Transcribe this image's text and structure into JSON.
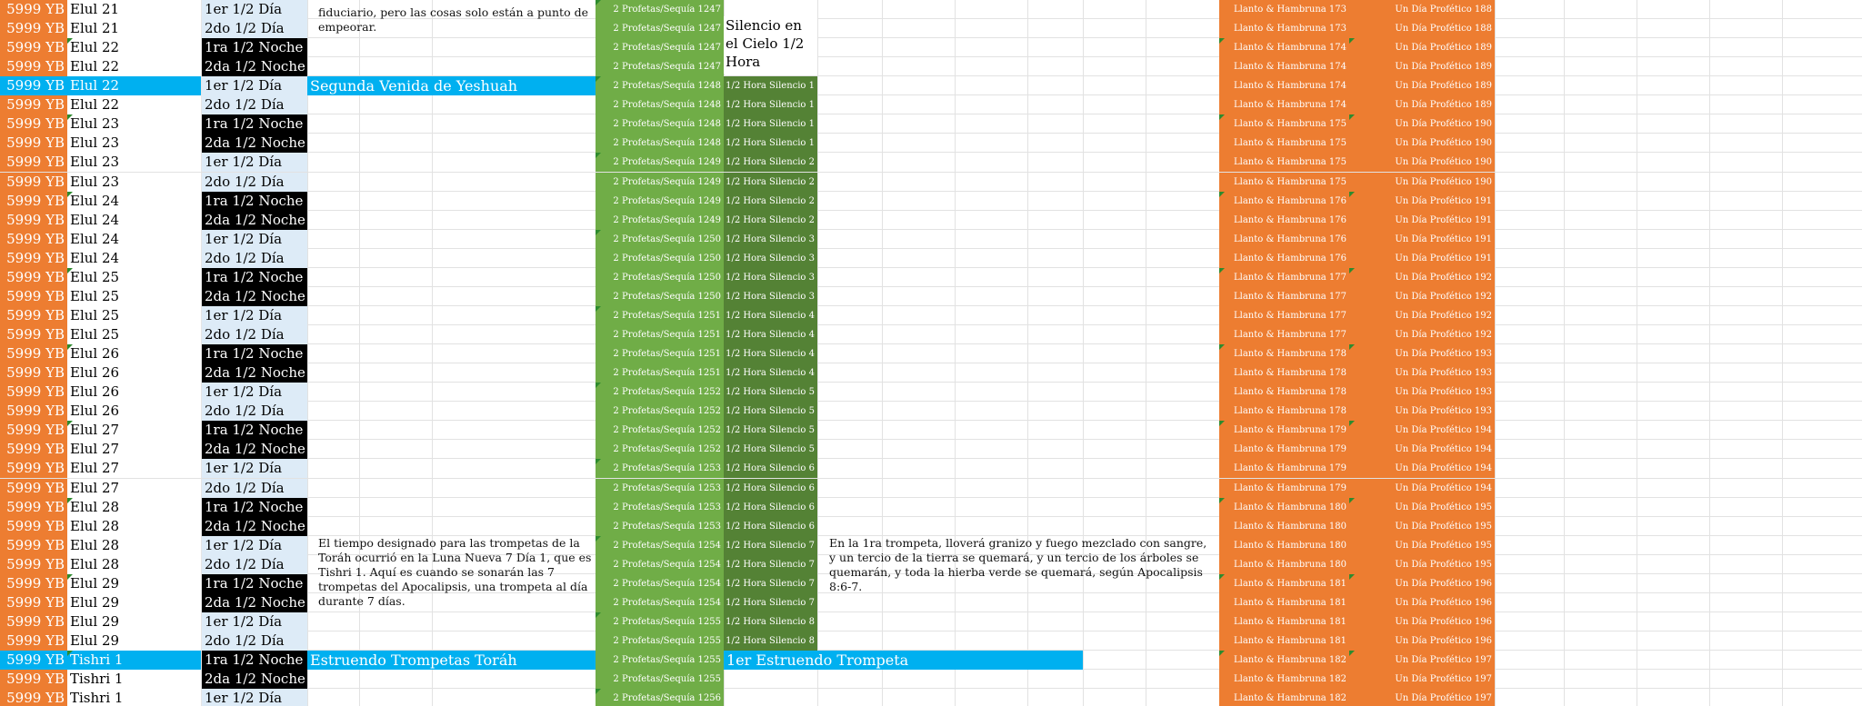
{
  "sheet": {
    "colors": {
      "orange": "#ed7d31",
      "cyan": "#00b0f0",
      "green": "#70ad47",
      "dark_green": "#548235",
      "day_blue": "#ddebf7",
      "night_black": "#000000"
    },
    "rows": [
      {
        "year": "5999 YB",
        "day": "Elul 21",
        "half": "1er 1/2 Día",
        "half_type": "d",
        "pro": "2 Profetas/Sequía  1247",
        "sil": "",
        "lla": "Llanto & Hambruna 173",
        "una": "Un Día Profético  188",
        "hi": false,
        "mark": false
      },
      {
        "year": "5999 YB",
        "day": "Elul 21",
        "half": "2do 1/2 Día",
        "half_type": "d",
        "pro": "2 Profetas/Sequía  1247",
        "sil": "",
        "lla": "Llanto & Hambruna 173",
        "una": "Un Día Profético  188",
        "hi": false,
        "mark": false
      },
      {
        "year": "5999 YB",
        "day": "Elul 22",
        "half": "1ra 1/2 Noche",
        "half_type": "n",
        "pro": "2 Profetas/Sequía  1247",
        "sil": "",
        "lla": "Llanto & Hambruna 174",
        "una": "Un Día Profético  189",
        "hi": false,
        "mark": true
      },
      {
        "year": "5999 YB",
        "day": "Elul 22",
        "half": "2da 1/2 Noche",
        "half_type": "n",
        "pro": "2 Profetas/Sequía  1247",
        "sil": "",
        "lla": "Llanto & Hambruna 174",
        "una": "Un Día Profético  189",
        "hi": false,
        "mark": false
      },
      {
        "year": "5999 YB",
        "day": "Elul 22",
        "half": "1er 1/2 Día",
        "half_type": "d",
        "pro": "2 Profetas/Sequía  1248",
        "sil": "1/2 Hora Silencio 1",
        "lla": "Llanto & Hambruna 174",
        "una": "Un Día Profético  189",
        "hi": true,
        "mark": false
      },
      {
        "year": "5999 YB",
        "day": "Elul 22",
        "half": "2do 1/2 Día",
        "half_type": "d",
        "pro": "2 Profetas/Sequía  1248",
        "sil": "1/2 Hora Silencio 1",
        "lla": "Llanto & Hambruna 174",
        "una": "Un Día Profético  189",
        "hi": false,
        "mark": false
      },
      {
        "year": "5999 YB",
        "day": "Elul 23",
        "half": "1ra 1/2 Noche",
        "half_type": "n",
        "pro": "2 Profetas/Sequía  1248",
        "sil": "1/2 Hora Silencio 1",
        "lla": "Llanto & Hambruna 175",
        "una": "Un Día Profético  190",
        "hi": false,
        "mark": true
      },
      {
        "year": "5999 YB",
        "day": "Elul 23",
        "half": "2da 1/2 Noche",
        "half_type": "n",
        "pro": "2 Profetas/Sequía  1248",
        "sil": "1/2 Hora Silencio 1",
        "lla": "Llanto & Hambruna 175",
        "una": "Un Día Profético  190",
        "hi": false,
        "mark": false
      },
      {
        "year": "5999 YB",
        "day": "Elul 23",
        "half": "1er 1/2 Día",
        "half_type": "d",
        "pro": "2 Profetas/Sequía  1249",
        "sil": "1/2 Hora Silencio  2",
        "lla": "Llanto & Hambruna 175",
        "una": "Un Día Profético  190",
        "hi": false,
        "mark": false
      },
      {
        "year": "5999 YB",
        "day": "Elul 23",
        "half": "2do 1/2 Día",
        "half_type": "d",
        "pro": "2 Profetas/Sequía  1249",
        "sil": "1/2 Hora Silencio  2",
        "lla": "Llanto & Hambruna 175",
        "una": "Un Día Profético  190",
        "hi": false,
        "mark": false
      },
      {
        "year": "5999 YB",
        "day": "Elul 24",
        "half": "1ra 1/2 Noche",
        "half_type": "n",
        "pro": "2 Profetas/Sequía  1249",
        "sil": "1/2 Hora Silencio  2",
        "lla": "Llanto & Hambruna 176",
        "una": "Un Día Profético  191",
        "hi": false,
        "mark": true
      },
      {
        "year": "5999 YB",
        "day": "Elul 24",
        "half": "2da 1/2 Noche",
        "half_type": "n",
        "pro": "2 Profetas/Sequía  1249",
        "sil": "1/2 Hora Silencio  2",
        "lla": "Llanto & Hambruna 176",
        "una": "Un Día Profético  191",
        "hi": false,
        "mark": false
      },
      {
        "year": "5999 YB",
        "day": "Elul 24",
        "half": "1er 1/2 Día",
        "half_type": "d",
        "pro": "2 Profetas/Sequía  1250",
        "sil": "1/2 Hora Silencio  3",
        "lla": "Llanto & Hambruna 176",
        "una": "Un Día Profético  191",
        "hi": false,
        "mark": false
      },
      {
        "year": "5999 YB",
        "day": "Elul 24",
        "half": "2do 1/2 Día",
        "half_type": "d",
        "pro": "2 Profetas/Sequía  1250",
        "sil": "1/2 Hora Silencio  3",
        "lla": "Llanto & Hambruna 176",
        "una": "Un Día Profético  191",
        "hi": false,
        "mark": false
      },
      {
        "year": "5999 YB",
        "day": "Elul 25",
        "half": "1ra 1/2 Noche",
        "half_type": "n",
        "pro": "2 Profetas/Sequía  1250",
        "sil": "1/2 Hora Silencio  3",
        "lla": "Llanto & Hambruna 177",
        "una": "Un Día Profético  192",
        "hi": false,
        "mark": true
      },
      {
        "year": "5999 YB",
        "day": "Elul 25",
        "half": "2da 1/2 Noche",
        "half_type": "n",
        "pro": "2 Profetas/Sequía  1250",
        "sil": "1/2 Hora Silencio  3",
        "lla": "Llanto & Hambruna 177",
        "una": "Un Día Profético  192",
        "hi": false,
        "mark": false
      },
      {
        "year": "5999 YB",
        "day": "Elul 25",
        "half": "1er 1/2 Día",
        "half_type": "d",
        "pro": "2 Profetas/Sequía  1251",
        "sil": "1/2 Hora Silencio  4",
        "lla": "Llanto & Hambruna 177",
        "una": "Un Día Profético  192",
        "hi": false,
        "mark": false
      },
      {
        "year": "5999 YB",
        "day": "Elul 25",
        "half": "2do 1/2 Día",
        "half_type": "d",
        "pro": "2 Profetas/Sequía  1251",
        "sil": "1/2 Hora Silencio  4",
        "lla": "Llanto & Hambruna 177",
        "una": "Un Día Profético  192",
        "hi": false,
        "mark": false
      },
      {
        "year": "5999 YB",
        "day": "Elul 26",
        "half": "1ra 1/2 Noche",
        "half_type": "n",
        "pro": "2 Profetas/Sequía  1251",
        "sil": "1/2 Hora Silencio  4",
        "lla": "Llanto & Hambruna 178",
        "una": "Un Día Profético  193",
        "hi": false,
        "mark": true
      },
      {
        "year": "5999 YB",
        "day": "Elul 26",
        "half": "2da 1/2 Noche",
        "half_type": "n",
        "pro": "2 Profetas/Sequía  1251",
        "sil": "1/2 Hora Silencio  4",
        "lla": "Llanto & Hambruna 178",
        "una": "Un Día Profético  193",
        "hi": false,
        "mark": false
      },
      {
        "year": "5999 YB",
        "day": "Elul 26",
        "half": "1er 1/2 Día",
        "half_type": "d",
        "pro": "2 Profetas/Sequía  1252",
        "sil": "1/2 Hora Silencio  5",
        "lla": "Llanto & Hambruna 178",
        "una": "Un Día Profético  193",
        "hi": false,
        "mark": false
      },
      {
        "year": "5999 YB",
        "day": "Elul 26",
        "half": "2do 1/2 Día",
        "half_type": "d",
        "pro": "2 Profetas/Sequía  1252",
        "sil": "1/2 Hora Silencio  5",
        "lla": "Llanto & Hambruna 178",
        "una": "Un Día Profético  193",
        "hi": false,
        "mark": false
      },
      {
        "year": "5999 YB",
        "day": "Elul 27",
        "half": "1ra 1/2 Noche",
        "half_type": "n",
        "pro": "2 Profetas/Sequía  1252",
        "sil": "1/2 Hora Silencio  5",
        "lla": "Llanto & Hambruna 179",
        "una": "Un Día Profético  194",
        "hi": false,
        "mark": true
      },
      {
        "year": "5999 YB",
        "day": "Elul 27",
        "half": "2da 1/2 Noche",
        "half_type": "n",
        "pro": "2 Profetas/Sequía  1252",
        "sil": "1/2 Hora Silencio  5",
        "lla": "Llanto & Hambruna 179",
        "una": "Un Día Profético  194",
        "hi": false,
        "mark": false
      },
      {
        "year": "5999 YB",
        "day": "Elul 27",
        "half": "1er 1/2 Día",
        "half_type": "d",
        "pro": "2 Profetas/Sequía  1253",
        "sil": "1/2 Hora Silencio  6",
        "lla": "Llanto & Hambruna 179",
        "una": "Un Día Profético  194",
        "hi": false,
        "mark": false
      },
      {
        "year": "5999 YB",
        "day": "Elul 27",
        "half": "2do 1/2 Día",
        "half_type": "d",
        "pro": "2 Profetas/Sequía  1253",
        "sil": "1/2 Hora Silencio  6",
        "lla": "Llanto & Hambruna 179",
        "una": "Un Día Profético  194",
        "hi": false,
        "mark": false
      },
      {
        "year": "5999 YB",
        "day": "Elul 28",
        "half": "1ra 1/2 Noche",
        "half_type": "n",
        "pro": "2 Profetas/Sequía  1253",
        "sil": "1/2 Hora Silencio  6",
        "lla": "Llanto & Hambruna 180",
        "una": "Un Día Profético  195",
        "hi": false,
        "mark": true
      },
      {
        "year": "5999 YB",
        "day": "Elul 28",
        "half": "2da 1/2 Noche",
        "half_type": "n",
        "pro": "2 Profetas/Sequía  1253",
        "sil": "1/2 Hora Silencio  6",
        "lla": "Llanto & Hambruna 180",
        "una": "Un Día Profético  195",
        "hi": false,
        "mark": false
      },
      {
        "year": "5999 YB",
        "day": "Elul 28",
        "half": "1er 1/2 Día",
        "half_type": "d",
        "pro": "2 Profetas/Sequía  1254",
        "sil": "1/2 Hora Silencio  7",
        "lla": "Llanto & Hambruna 180",
        "una": "Un Día Profético  195",
        "hi": false,
        "mark": false
      },
      {
        "year": "5999 YB",
        "day": "Elul 28",
        "half": "2do 1/2 Día",
        "half_type": "d",
        "pro": "2 Profetas/Sequía  1254",
        "sil": "1/2 Hora Silencio  7",
        "lla": "Llanto & Hambruna 180",
        "una": "Un Día Profético  195",
        "hi": false,
        "mark": false
      },
      {
        "year": "5999 YB",
        "day": "Elul 29",
        "half": "1ra 1/2 Noche",
        "half_type": "n",
        "pro": "2 Profetas/Sequía  1254",
        "sil": "1/2 Hora Silencio  7",
        "lla": "Llanto & Hambruna 181",
        "una": "Un Día Profético  196",
        "hi": false,
        "mark": true
      },
      {
        "year": "5999 YB",
        "day": "Elul 29",
        "half": "2da 1/2 Noche",
        "half_type": "n",
        "pro": "2 Profetas/Sequía  1254",
        "sil": "1/2 Hora Silencio  7",
        "lla": "Llanto & Hambruna 181",
        "una": "Un Día Profético  196",
        "hi": false,
        "mark": false
      },
      {
        "year": "5999 YB",
        "day": "Elul 29",
        "half": "1er 1/2 Día",
        "half_type": "d",
        "pro": "2 Profetas/Sequía  1255",
        "sil": "1/2 Hora Silencio  8",
        "lla": "Llanto & Hambruna 181",
        "una": "Un Día Profético  196",
        "hi": false,
        "mark": false
      },
      {
        "year": "5999 YB",
        "day": "Elul 29",
        "half": "2do 1/2 Día",
        "half_type": "d",
        "pro": "2 Profetas/Sequía  1255",
        "sil": "1/2 Hora Silencio  8",
        "lla": "Llanto & Hambruna 181",
        "una": "Un Día Profético  196",
        "hi": false,
        "mark": false
      },
      {
        "year": "5999 YB",
        "day": "Tishri 1",
        "half": "1ra 1/2 Noche",
        "half_type": "n",
        "pro": "2 Profetas/Sequía  1255",
        "sil": "",
        "lla": "Llanto & Hambruna 182",
        "una": "Un Día Profético  197",
        "hi": true,
        "mark": true
      },
      {
        "year": "5999 YB",
        "day": "Tishri 1",
        "half": "2da 1/2 Noche",
        "half_type": "n",
        "pro": "2 Profetas/Sequía  1255",
        "sil": "",
        "lla": "Llanto & Hambruna 182",
        "una": "Un Día Profético  197",
        "hi": false,
        "mark": false
      },
      {
        "year": "5999 YB",
        "day": "Tishri 1",
        "half": "1er 1/2 Día",
        "half_type": "d",
        "pro": "2 Profetas/Sequía  1256",
        "sil": "",
        "lla": "Llanto & Hambruna 182",
        "una": "Un Día Profético  197",
        "hi": false,
        "mark": false
      }
    ],
    "highlights": {
      "segunda_venida": "Segunda Venida de Yeshuah",
      "estruendo_torah": "Estruendo Trompetas Toráh",
      "primer_estruendo": "1er Estruendo Trompeta"
    },
    "silence_header": "Silencio en el Cielo 1/2 Hora",
    "notes": {
      "top": "fiduciario, pero las cosas solo están a punto de empeorar.",
      "trumpets": "El tiempo designado para las trompetas de la Toráh ocurrió en la Luna Nueva 7 Día 1, que es Tishri 1. Aquí es cuando se sonarán las 7 trompetas del Apocalipsis, una trompeta al día durante 7 días.",
      "first_trumpet": "En la 1ra trompeta, lloverá granizo y fuego mezclado con sangre, y un tercio de la tierra se quemará, y un tercio de los árboles se quemarán, y toda la hierba verde se quemará, según Apocalipsis 8:6-7."
    }
  }
}
